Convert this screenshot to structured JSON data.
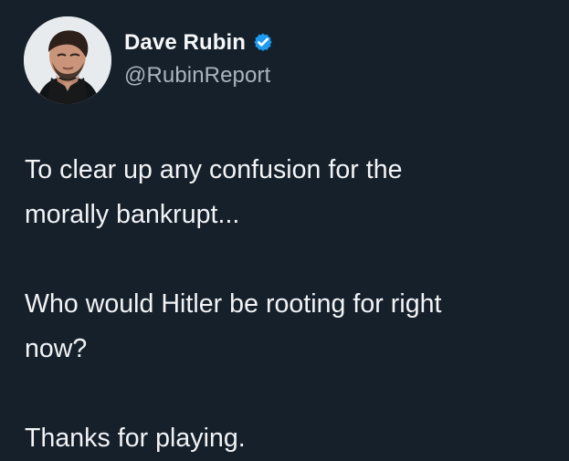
{
  "tweet": {
    "author": {
      "display_name": "Dave Rubin",
      "handle": "@RubinReport",
      "verified_icon": "verified-badge-icon",
      "avatar_icon": "avatar"
    },
    "paragraphs": [
      "To clear up any confusion for the\nmorally bankrupt...",
      "Who would Hitler be rooting for right\nnow?",
      "Thanks for playing."
    ]
  },
  "colors": {
    "background": "#16202b",
    "primary_text": "#f3f5f7",
    "secondary_text": "#aab4bd",
    "verified_blue": "#1d9bf0"
  }
}
